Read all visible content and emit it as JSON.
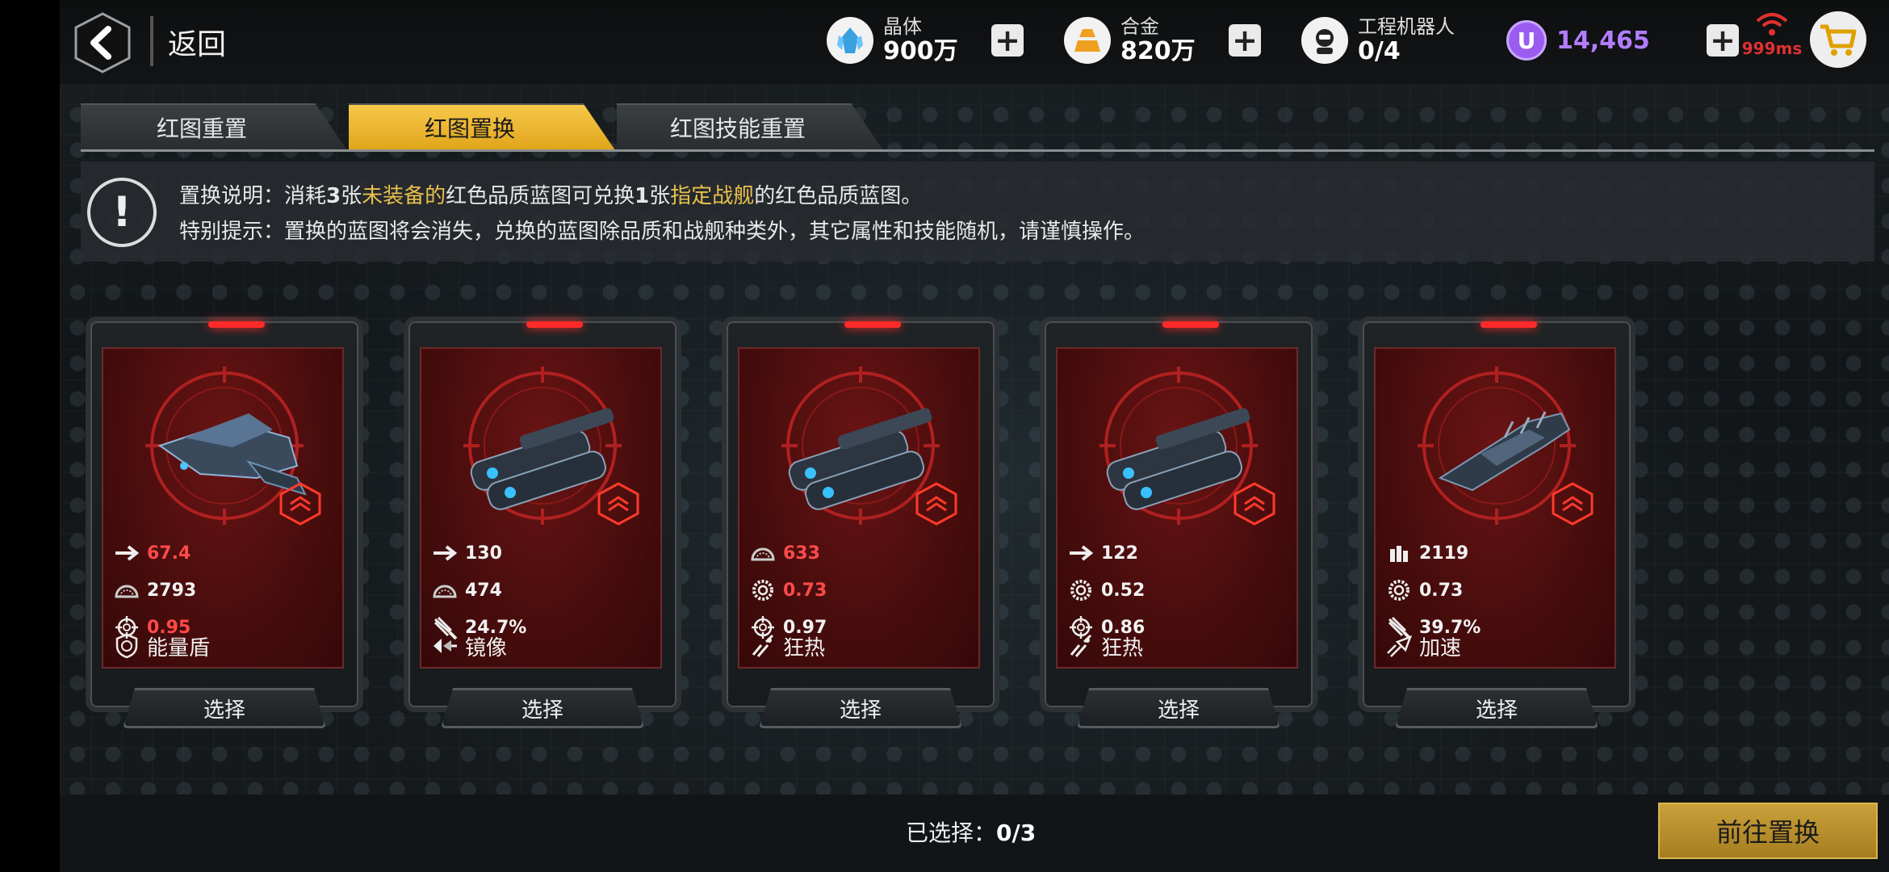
{
  "header": {
    "back_label": "返回",
    "resources": [
      {
        "name": "晶体",
        "value": "900万",
        "icon": "crystal-icon",
        "color": "#7fc8ff"
      },
      {
        "name": "合金",
        "value": "820万",
        "icon": "alloy-icon",
        "color": "#f0a020"
      },
      {
        "name": "工程机器人",
        "value": "0/4",
        "icon": "robot-icon",
        "color": "#dddddd"
      }
    ],
    "currency": {
      "value": "14,465",
      "icon": "u-coin-icon",
      "color": "#9b5cf0"
    },
    "ping": "999ms",
    "ping_color": "#e03030"
  },
  "tabs": [
    {
      "label": "红图重置",
      "active": false
    },
    {
      "label": "红图置换",
      "active": true
    },
    {
      "label": "红图技能重置",
      "active": false
    }
  ],
  "info": {
    "l1_a": "置换说明：消耗",
    "l1_b": "3",
    "l1_c": "张",
    "l1_d": "未装备的",
    "l1_e": "红色品质蓝图可兑换",
    "l1_f": "1",
    "l1_g": "张",
    "l1_h": "指定战舰",
    "l1_i": "的红色品质蓝图。",
    "line2": "特别提示：置换的蓝图将会消失，兑换的蓝图除品质和战舰种类外，其它属性和技能随机，请谨慎操作。"
  },
  "cards": [
    {
      "ship": "fighter",
      "stats": [
        {
          "icon": "arrow-icon",
          "value": "67.4",
          "red": true
        },
        {
          "icon": "dial-icon",
          "value": "2793",
          "red": false
        },
        {
          "icon": "crosshair-icon",
          "value": "0.95",
          "red": true
        }
      ],
      "skill": {
        "icon": "shield-icon",
        "label": "能量盾"
      },
      "button": "选择"
    },
    {
      "ship": "cruiser",
      "stats": [
        {
          "icon": "arrow-icon",
          "value": "130",
          "red": false
        },
        {
          "icon": "dial-icon",
          "value": "474",
          "red": false
        },
        {
          "icon": "missile-icon",
          "value": "24.7%",
          "red": false
        }
      ],
      "skill": {
        "icon": "mirror-icon",
        "label": "镜像"
      },
      "button": "选择"
    },
    {
      "ship": "cruiser",
      "stats": [
        {
          "icon": "dial-icon",
          "value": "633",
          "red": true
        },
        {
          "icon": "gear-icon",
          "value": "0.73",
          "red": true
        },
        {
          "icon": "crosshair-icon",
          "value": "0.97",
          "red": false
        }
      ],
      "skill": {
        "icon": "frenzy-icon",
        "label": "狂热"
      },
      "button": "选择"
    },
    {
      "ship": "cruiser",
      "stats": [
        {
          "icon": "arrow-icon",
          "value": "122",
          "red": false
        },
        {
          "icon": "gear-icon",
          "value": "0.52",
          "red": false
        },
        {
          "icon": "crosshair-icon",
          "value": "0.86",
          "red": false
        }
      ],
      "skill": {
        "icon": "frenzy-icon",
        "label": "狂热"
      },
      "button": "选择"
    },
    {
      "ship": "frigate",
      "stats": [
        {
          "icon": "ammo-icon",
          "value": "2119",
          "red": false
        },
        {
          "icon": "gear-icon",
          "value": "0.73",
          "red": false
        },
        {
          "icon": "missile-icon",
          "value": "39.7%",
          "red": false
        }
      ],
      "skill": {
        "icon": "boost-icon",
        "label": "加速"
      },
      "button": "选择"
    }
  ],
  "footer": {
    "selected_label": "已选择：",
    "selected_value": "0/3",
    "go_button": "前往置换"
  }
}
